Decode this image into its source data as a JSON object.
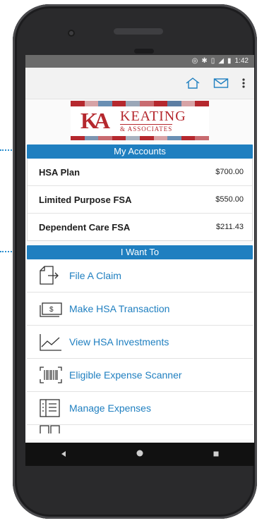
{
  "status_bar": {
    "time": "1:42",
    "icons": [
      "nfc-icon",
      "bluetooth-icon",
      "vibrate-icon",
      "signal-icon",
      "battery-icon"
    ]
  },
  "app_bar": {
    "icons": [
      "home-icon",
      "mail-icon",
      "overflow-menu-icon"
    ]
  },
  "logo": {
    "mark": "KA",
    "name": "KEATING",
    "sub": "& ASSOCIATES"
  },
  "my_accounts": {
    "header": "My Accounts",
    "rows": [
      {
        "name": "HSA Plan",
        "amount": "$700.00"
      },
      {
        "name": "Limited Purpose FSA",
        "amount": "$550.00"
      },
      {
        "name": "Dependent Care FSA",
        "amount": "$211.43"
      }
    ]
  },
  "i_want_to": {
    "header": "I Want To",
    "items": [
      {
        "label": "File A Claim",
        "icon": "file-claim-icon"
      },
      {
        "label": "Make HSA Transaction",
        "icon": "dollar-bill-icon"
      },
      {
        "label": "View HSA Investments",
        "icon": "line-chart-icon"
      },
      {
        "label": "Eligible Expense Scanner",
        "icon": "barcode-scanner-icon"
      },
      {
        "label": "Manage Expenses",
        "icon": "receipt-list-icon"
      }
    ]
  },
  "colors": {
    "accent": "#1f7fc0",
    "logo_red": "#b5282e",
    "nav_bar": "#111111"
  }
}
